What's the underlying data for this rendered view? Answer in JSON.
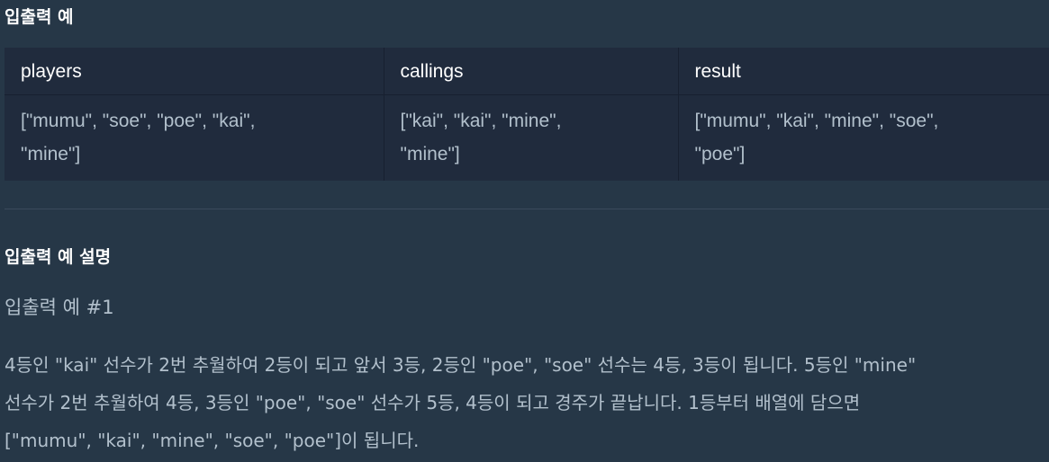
{
  "io_section": {
    "title": "입출력 예",
    "headers": [
      "players",
      "callings",
      "result"
    ],
    "row": {
      "players": [
        "[\"mumu\", \"soe\", \"poe\", \"kai\",",
        "\"mine\"]"
      ],
      "callings": [
        "[\"kai\", \"kai\", \"mine\",",
        "\"mine\"]"
      ],
      "result": [
        "[\"mumu\", \"kai\", \"mine\", \"soe\",",
        "\"poe\"]"
      ]
    }
  },
  "explanation": {
    "title": "입출력 예 설명",
    "example_label": "입출력 예 #1",
    "lines": [
      "4등인 \"kai\" 선수가 2번 추월하여 2등이 되고 앞서 3등, 2등인 \"poe\", \"soe\" 선수는 4등, 3등이 됩니다. 5등인 \"mine\"",
      "선수가 2번 추월하여 4등, 3등인 \"poe\", \"soe\" 선수가 5등, 4등이 되고 경주가 끝납니다. 1등부터 배열에 담으면",
      "[\"mumu\", \"kai\", \"mine\", \"soe\", \"poe\"]이 됩니다."
    ]
  }
}
